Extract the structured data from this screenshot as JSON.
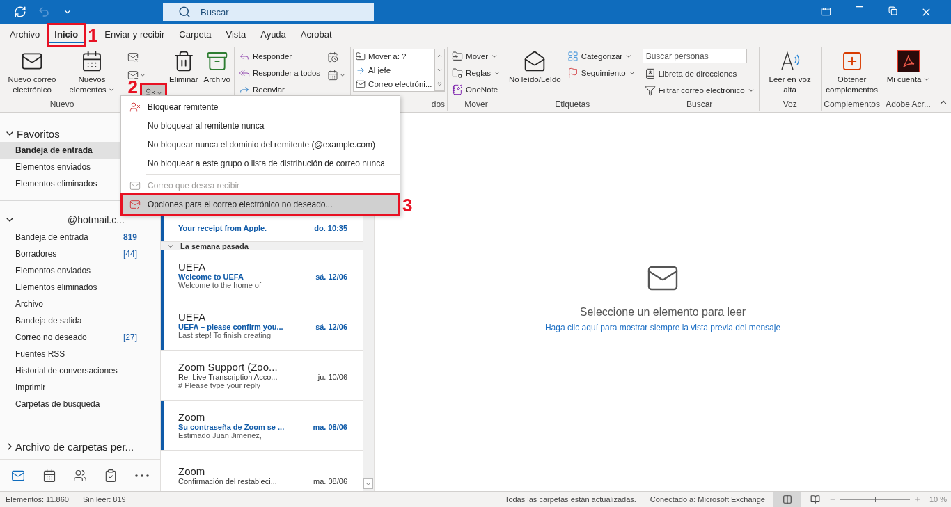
{
  "title_bar": {
    "search": {
      "placeholder": "Buscar"
    },
    "undo_disabled": true
  },
  "tabs": [
    {
      "label": "Archivo",
      "selected": false
    },
    {
      "label": "Inicio",
      "selected": true,
      "annotation": {
        "label": "1",
        "number_left": false
      }
    },
    {
      "label": "Enviar y recibir",
      "selected": false
    },
    {
      "label": "Carpeta",
      "selected": false
    },
    {
      "label": "Vista",
      "selected": false
    },
    {
      "label": "Ayuda",
      "selected": false
    },
    {
      "label": "Acrobat",
      "selected": false
    }
  ],
  "ribbon": {
    "groups": [
      {
        "label": "Nuevo",
        "controls": [
          {
            "kind": "large",
            "label": "Nuevo correo electrónico",
            "dropdown": false
          },
          {
            "kind": "large",
            "label": "Nuevos elementos",
            "dropdown": true
          }
        ]
      },
      {
        "controls": [
          {
            "kind": "icon_stack",
            "items": [
              {
                "dropdown": false,
                "pressed": false
              },
              {
                "dropdown": true,
                "pressed": false
              },
              {
                "dropdown": true,
                "pressed": true,
                "annotation": {
                  "label": "2",
                  "number_left": true
                }
              }
            ]
          },
          {
            "kind": "large",
            "label": "Eliminar",
            "dropdown": false
          },
          {
            "kind": "large",
            "label": "Archivo",
            "dropdown": false
          }
        ]
      },
      {
        "controls": [
          {
            "kind": "small_stack",
            "items": [
              {
                "label": "Responder",
                "dropdown": false
              },
              {
                "label": "Responder a todos",
                "dropdown": false
              },
              {
                "label": "Reenviar",
                "dropdown": false
              }
            ]
          },
          {
            "kind": "icon_stack",
            "items": [
              {
                "dropdown": false,
                "pressed": false
              },
              {
                "dropdown": true,
                "pressed": false
              }
            ]
          }
        ]
      },
      {
        "label": "dos",
        "controls": [
          {
            "kind": "quick_steps",
            "items": [
              "Mover a: ?",
              "Al jefe",
              "Correo electróni..."
            ]
          }
        ]
      },
      {
        "label": "Mover",
        "controls": [
          {
            "kind": "small_stack",
            "items": [
              {
                "label": "Mover",
                "dropdown": true
              },
              {
                "label": "Reglas",
                "dropdown": true
              },
              {
                "label": "OneNote",
                "dropdown": false
              }
            ]
          }
        ]
      },
      {
        "label": "Etiquetas",
        "controls": [
          {
            "kind": "large",
            "label": "No leído/Leído",
            "dropdown": false
          },
          {
            "kind": "small_stack",
            "items": [
              {
                "label": "Categorizar",
                "dropdown": true
              },
              {
                "label": "Seguimiento",
                "dropdown": true
              }
            ]
          }
        ]
      },
      {
        "label": "Buscar",
        "controls": [
          {
            "kind": "search",
            "placeholder": "Buscar personas",
            "items": [
              {
                "label": "Libreta de direcciones",
                "dropdown": false
              },
              {
                "label": "Filtrar correo electrónico",
                "dropdown": true
              }
            ]
          }
        ]
      },
      {
        "label": "Voz",
        "controls": [
          {
            "kind": "large",
            "label": "Leer en voz alta",
            "dropdown": false
          }
        ]
      },
      {
        "label": "Complementos",
        "controls": [
          {
            "kind": "large",
            "label": "Obtener complementos",
            "dropdown": false
          }
        ]
      },
      {
        "label": "Adobe Acr...",
        "controls": [
          {
            "kind": "large",
            "label": "Mi cuenta",
            "dropdown": true
          }
        ]
      }
    ]
  },
  "junk_menu": {
    "items": [
      {
        "kind": "item",
        "label": "Bloquear remitente",
        "disabled": false,
        "selected": false
      },
      {
        "kind": "item",
        "label": "No bloquear al remitente nunca",
        "disabled": false,
        "selected": false
      },
      {
        "kind": "item",
        "label": "No bloquear nunca el dominio del remitente (@example.com)",
        "disabled": false,
        "selected": false
      },
      {
        "kind": "item",
        "label": "No bloquear a este grupo o lista de distribución de correo nunca",
        "disabled": false,
        "selected": false
      },
      {
        "kind": "separator"
      },
      {
        "kind": "item",
        "label": "Correo que desea recibir",
        "disabled": true,
        "selected": false
      },
      {
        "kind": "item",
        "label": "Opciones para el correo electrónico no deseado...",
        "disabled": false,
        "selected": true,
        "annotation": {
          "label": "3",
          "number_left": false
        }
      }
    ]
  },
  "sidebar": {
    "favorites": {
      "label": "Favoritos",
      "expanded": true,
      "items": [
        {
          "label": "Bandeja de entrada",
          "selected": true
        },
        {
          "label": "Elementos enviados",
          "selected": false
        },
        {
          "label": "Elementos eliminados",
          "selected": false
        }
      ]
    },
    "account": {
      "label": "@hotmail.c...",
      "expanded": true,
      "folders": [
        {
          "label": "Bandeja de entrada",
          "count": "819",
          "count_bold": true
        },
        {
          "label": "Borradores",
          "count": "[44]",
          "count_bold": false
        },
        {
          "label": "Elementos enviados"
        },
        {
          "label": "Elementos eliminados"
        },
        {
          "label": "Archivo"
        },
        {
          "label": "Bandeja de salida"
        },
        {
          "label": "Correo no deseado",
          "count": "[27]",
          "count_bold": false
        },
        {
          "label": "Fuentes RSS"
        },
        {
          "label": "Historial de conversaciones"
        },
        {
          "label": "Imprimir"
        },
        {
          "label": "Carpetas de búsqueda"
        }
      ]
    },
    "archive": {
      "label": "Archivo de carpetas per...",
      "expanded": false
    },
    "nav": [
      {
        "selected": true
      },
      {
        "selected": false
      },
      {
        "selected": false
      },
      {
        "selected": false
      },
      {
        "selected": false
      }
    ]
  },
  "message_list": {
    "sections": [
      {
        "items": [
          {
            "subject": "Your receipt from Apple.",
            "date": "do. 10:35",
            "unread": true
          }
        ]
      },
      {
        "header": "La semana pasada",
        "expanded": true,
        "items": [
          {
            "sender": "UEFA",
            "subject": "Welcome to UEFA",
            "date": "sá. 12/06",
            "preview": "Welcome to the home of",
            "unread": true
          },
          {
            "sender": "UEFA",
            "subject": "UEFA – please confirm you...",
            "date": "sá. 12/06",
            "preview": "Last step! To finish creating",
            "unread": true
          },
          {
            "sender": "Zoom Support (Zoo...",
            "subject": "Re: Live Transcription Acco...",
            "date": "ju. 10/06",
            "preview": "# Please type your reply",
            "unread": false
          },
          {
            "sender": "Zoom",
            "subject": "Su contraseña de Zoom se ...",
            "date": "ma. 08/06",
            "preview": "Estimado Juan Jimenez,",
            "unread": true
          },
          {
            "sender": "Zoom",
            "subject": "Confirmación del restableci...",
            "date": "ma. 08/06",
            "unread": false
          }
        ]
      }
    ]
  },
  "reading_pane": {
    "message": "Seleccione un elemento para leer",
    "link": "Haga clic aquí para mostrar siempre la vista previa del mensaje"
  },
  "status_bar": {
    "items_count": "Elementos: 11.860",
    "unread": "Sin leer: 819",
    "sync": "Todas las carpetas están actualizadas.",
    "connection": "Conectado a: Microsoft Exchange",
    "views": [
      {
        "selected": true
      },
      {
        "selected": false
      }
    ],
    "zoom": {
      "level": 0.5,
      "reading": "10 %"
    }
  }
}
